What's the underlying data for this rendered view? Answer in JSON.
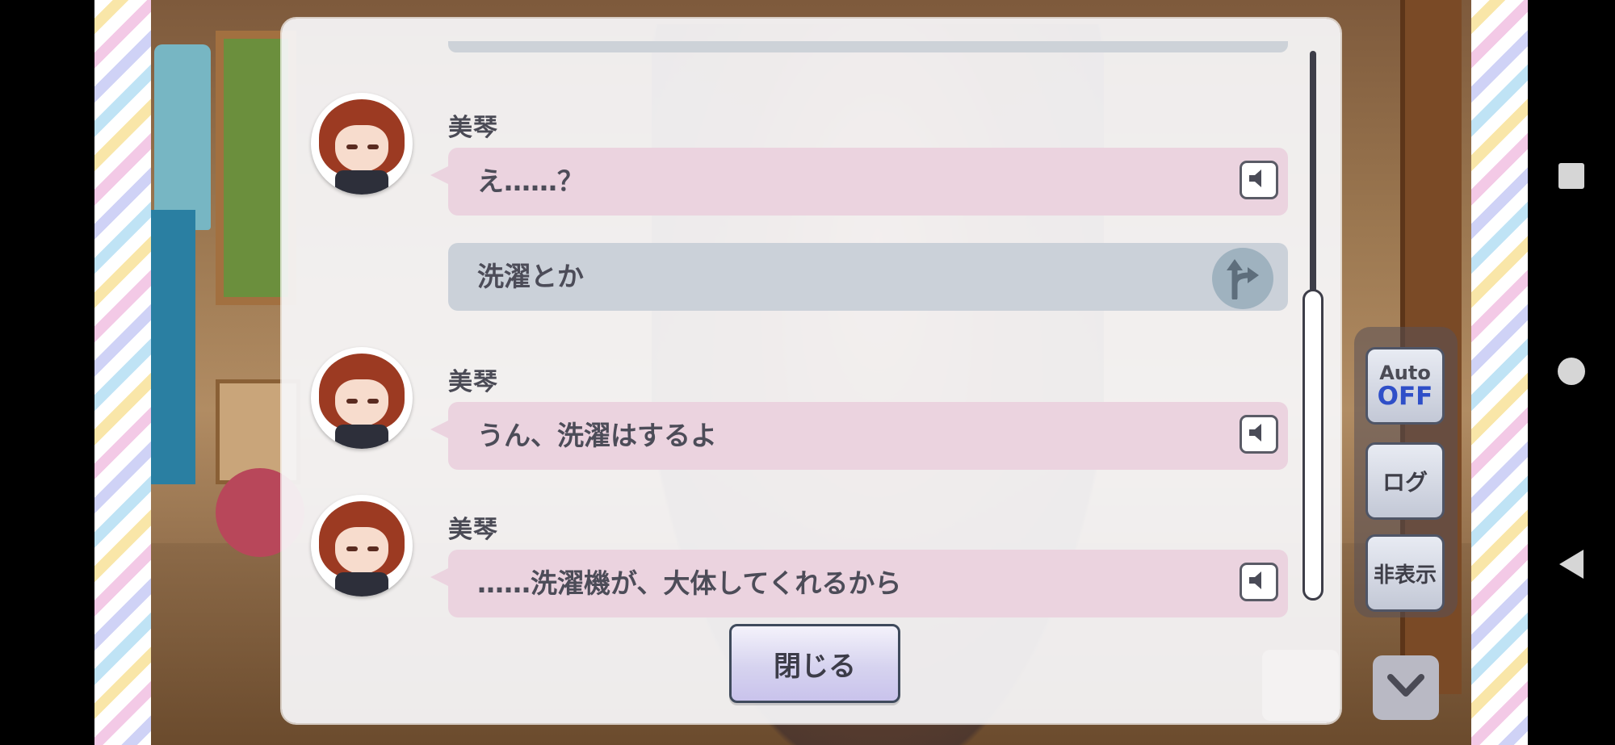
{
  "log": {
    "entries": [
      {
        "speaker": "美琴",
        "text": "え……？"
      },
      {
        "choice": "洗濯とか"
      },
      {
        "speaker": "美琴",
        "text": "うん、洗濯はするよ"
      },
      {
        "speaker": "美琴",
        "text": "……洗濯機が、大体してくれるから"
      }
    ],
    "close_label": "閉じる"
  },
  "controls": {
    "auto_label": "Auto",
    "auto_state": "OFF",
    "log_label": "ログ",
    "hide_label": "非表示"
  },
  "icons": {
    "voice": "speaker-icon",
    "choice": "branch-arrow-icon",
    "down": "chevron-down-icon",
    "nav": [
      "square-icon",
      "circle-icon",
      "triangle-back-icon"
    ]
  }
}
